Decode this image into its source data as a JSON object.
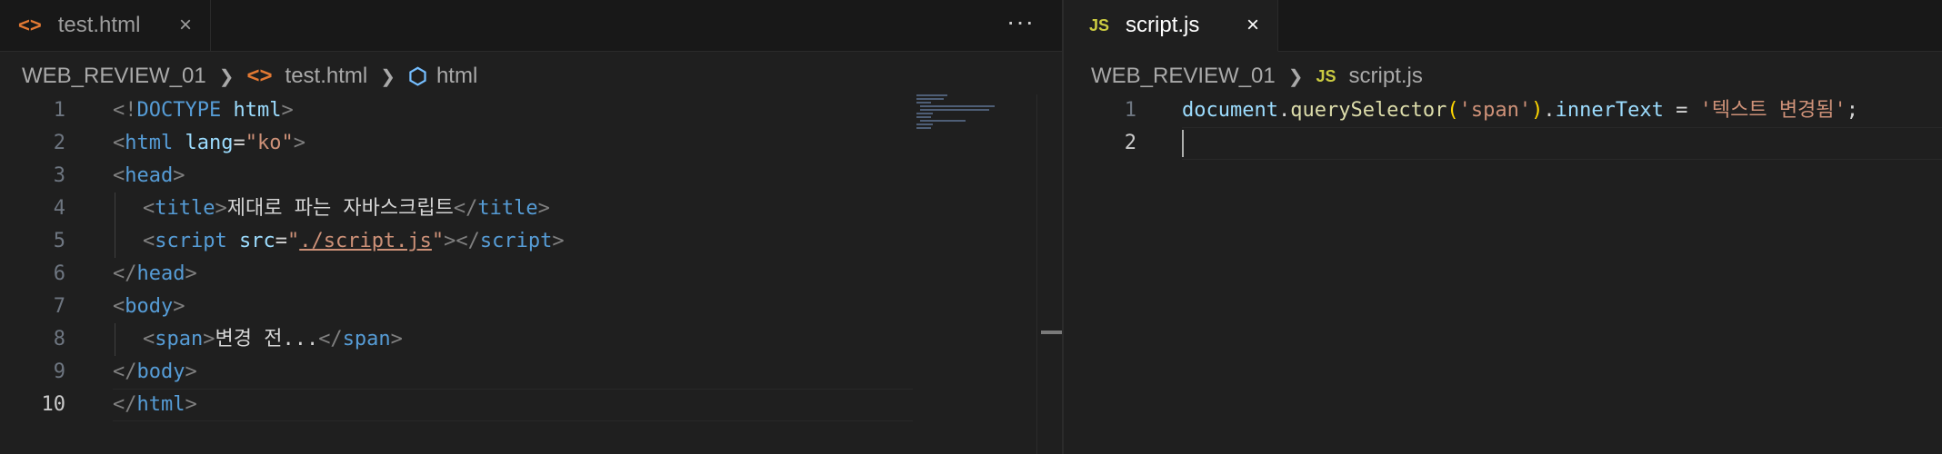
{
  "left": {
    "tab": {
      "icon": "<>",
      "label": "test.html",
      "close": "×"
    },
    "more": "···",
    "breadcrumb": {
      "root": "WEB_REVIEW_01",
      "file_icon": "<>",
      "file": "test.html",
      "symbol_icon": "⬡",
      "symbol": "html"
    },
    "line_numbers": [
      "1",
      "2",
      "3",
      "4",
      "5",
      "6",
      "7",
      "8",
      "9",
      "10"
    ],
    "code": {
      "l1": {
        "a": "<!",
        "b": "DOCTYPE",
        "c": " html",
        "d": ">"
      },
      "l2": {
        "a": "<",
        "b": "html",
        "c": " lang",
        "d": "=",
        "e": "\"ko\"",
        "f": ">"
      },
      "l3": {
        "a": "<",
        "b": "head",
        "c": ">"
      },
      "l4": {
        "a": "<",
        "b": "title",
        "c": ">",
        "d": "제대로 파는 자바스크립트",
        "e": "</",
        "f": "title",
        "g": ">"
      },
      "l5": {
        "a": "<",
        "b": "script",
        "c": " src",
        "d": "=",
        "e": "\"",
        "f": "./script.js",
        "g": "\"",
        "h": "></",
        "i": "script",
        "j": ">"
      },
      "l6": {
        "a": "</",
        "b": "head",
        "c": ">"
      },
      "l7": {
        "a": "<",
        "b": "body",
        "c": ">"
      },
      "l8": {
        "a": "<",
        "b": "span",
        "c": ">",
        "d": "변경 전...",
        "e": "</",
        "f": "span",
        "g": ">"
      },
      "l9": {
        "a": "</",
        "b": "body",
        "c": ">"
      },
      "l10": {
        "a": "</",
        "b": "html",
        "c": ">"
      }
    }
  },
  "right": {
    "tab": {
      "icon": "JS",
      "label": "script.js",
      "close": "×"
    },
    "breadcrumb": {
      "root": "WEB_REVIEW_01",
      "file_icon": "JS",
      "file": "script.js"
    },
    "line_numbers": [
      "1",
      "2"
    ],
    "code": {
      "l1": {
        "a": "document",
        "b": ".",
        "c": "querySelector",
        "d": "(",
        "e": "'span'",
        "f": ")",
        "g": ".",
        "h": "innerText",
        "i": " = ",
        "j": "'텍스트 변경됨'",
        "k": ";"
      }
    }
  },
  "colors": {
    "background": "#1f1f1f",
    "tag_name": "#569cd6",
    "attribute": "#9cdcfe",
    "string": "#ce9178",
    "function": "#dcdcaa",
    "js_icon": "#cbcb41",
    "html_icon": "#e37933"
  }
}
